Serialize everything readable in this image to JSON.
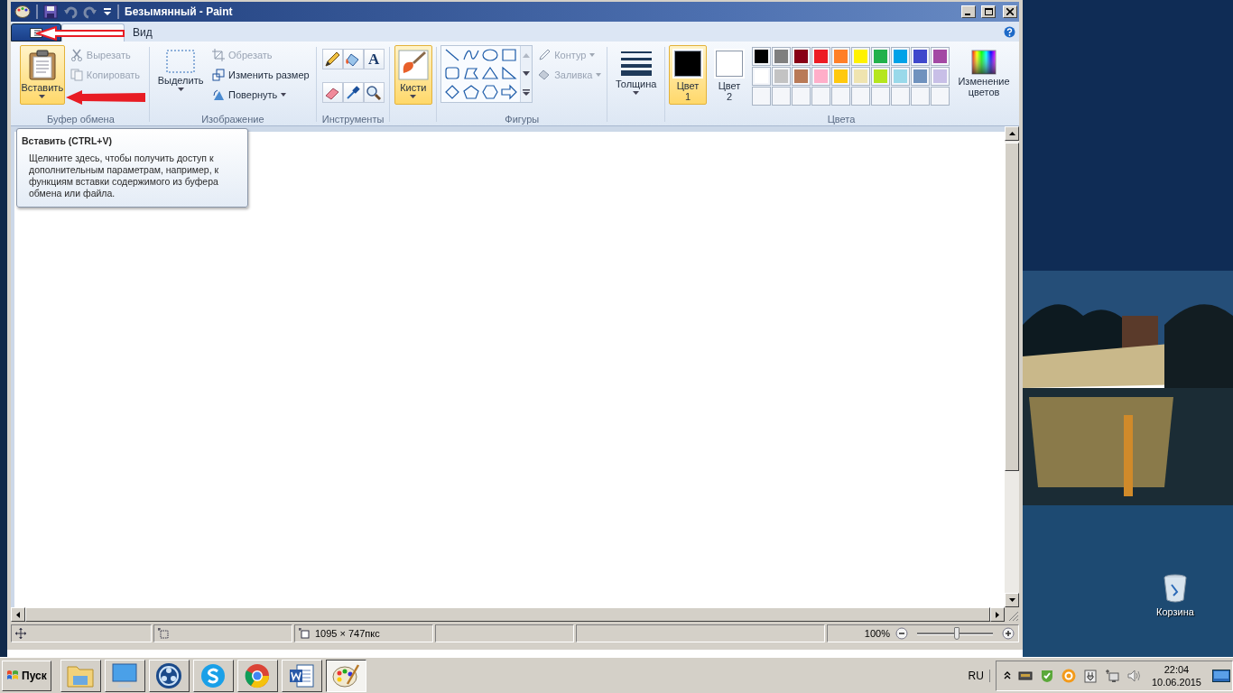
{
  "window": {
    "title": "Безымянный - Paint"
  },
  "tabs": [
    {
      "selected": true
    },
    {
      "label": "Вид",
      "selected": false
    }
  ],
  "clipboard": {
    "label": "Буфер обмена",
    "paste": {
      "label": "Вставить",
      "highlighted": true
    },
    "cut": {
      "label": "Вырезать",
      "disabled": true
    },
    "copy": {
      "label": "Копировать",
      "disabled": true
    }
  },
  "image": {
    "label": "Изображение",
    "select": "Выделить",
    "crop": {
      "label": "Обрезать",
      "disabled": true
    },
    "resize": {
      "label": "Изменить размер",
      "disabled": false
    },
    "rotate": {
      "label": "Повернуть",
      "disabled": false
    }
  },
  "tools": {
    "label": "Инструменты",
    "text_tool": "A"
  },
  "brushes": {
    "label": "Кисти",
    "selected": true
  },
  "shapes": {
    "label": "Фигуры",
    "outline": {
      "label": "Контур",
      "disabled": true
    },
    "fill": {
      "label": "Заливка",
      "disabled": true
    }
  },
  "thickness": {
    "label": "Толщина"
  },
  "colors": {
    "label": "Цвета",
    "edit": "Изменение цветов",
    "current": [
      {
        "label": "Цвет",
        "number": "1",
        "color": "#000000",
        "selected": true
      },
      {
        "label": "Цвет",
        "number": "2",
        "color": "#ffffff",
        "selected": false
      }
    ],
    "palette": [
      {
        "color": "#000000"
      },
      {
        "color": "#7f7f7f"
      },
      {
        "color": "#880015"
      },
      {
        "color": "#ed1c24"
      },
      {
        "color": "#ff7f27"
      },
      {
        "color": "#fff200"
      },
      {
        "color": "#22b14c"
      },
      {
        "color": "#00a2e8"
      },
      {
        "color": "#3f48cc"
      },
      {
        "color": "#a349a4"
      },
      {
        "color": "#ffffff"
      },
      {
        "color": "#c3c3c3"
      },
      {
        "color": "#b97a57"
      },
      {
        "color": "#ffaec9"
      },
      {
        "color": "#ffc90e"
      },
      {
        "color": "#efe4b0"
      },
      {
        "color": "#b5e61d"
      },
      {
        "color": "#99d9ea"
      },
      {
        "color": "#7092be"
      },
      {
        "color": "#c8bfe7"
      }
    ]
  },
  "tooltip": {
    "title": "Вставить (CTRL+V)",
    "text": "Щелкните здесь, чтобы получить доступ к дополнительным параметрам, например, к функциям вставки содержимого из буфера обмена или файла."
  },
  "status_bar": {
    "size": "1095 × 747пкс",
    "zoom": "100%",
    "zoom_slider": {
      "level": 0.52
    }
  },
  "desktop": {
    "icons": [
      {
        "label": "Корзина"
      }
    ]
  },
  "taskbar": {
    "start": "Пуск",
    "apps": [
      {
        "kind": "folder",
        "selected": false
      },
      {
        "kind": "monitor",
        "selected": false
      },
      {
        "kind": "media",
        "selected": false
      },
      {
        "kind": "chat",
        "selected": false
      },
      {
        "kind": "browser",
        "selected": false
      },
      {
        "kind": "document",
        "selected": false
      },
      {
        "kind": "paint",
        "selected": true
      }
    ],
    "language": "RU",
    "time": "22:04",
    "date": "10.06.2015"
  }
}
